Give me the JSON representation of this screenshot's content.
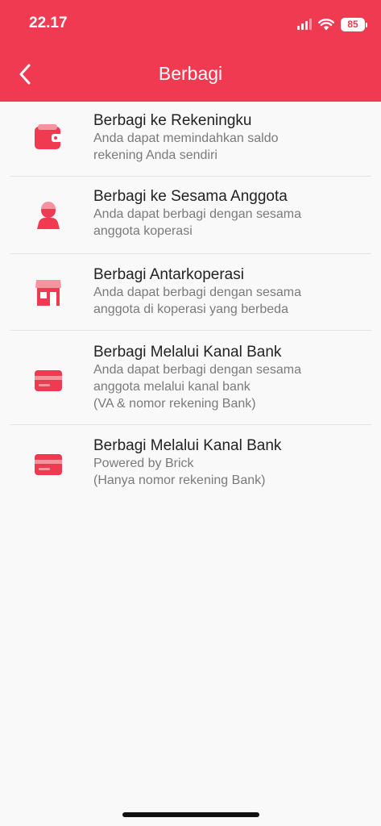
{
  "status_bar": {
    "time": "22.17",
    "battery": "85"
  },
  "nav": {
    "title": "Berbagi",
    "back_icon": "chevron-left-icon"
  },
  "colors": {
    "brand": "#f03a52",
    "background": "#f9f9f9",
    "divider": "#e4e4e4"
  },
  "menu": [
    {
      "title": "Berbagi ke Rekeningku",
      "desc": [
        "Anda dapat memindahkan saldo",
        "rekening Anda sendiri"
      ],
      "icon": "wallet-icon"
    },
    {
      "title": "Berbagi ke Sesama Anggota",
      "desc": [
        "Anda dapat berbagi dengan sesama",
        "anggota koperasi"
      ],
      "icon": "person-icon"
    },
    {
      "title": "Berbagi Antarkoperasi",
      "desc": [
        "Anda dapat berbagi dengan sesama",
        "anggota di koperasi yang berbeda"
      ],
      "icon": "store-icon"
    },
    {
      "title": "Berbagi Melalui Kanal Bank",
      "desc": [
        "Anda dapat berbagi dengan sesama",
        "anggota melalui kanal bank",
        "(VA & nomor rekening Bank)"
      ],
      "icon": "card-icon"
    },
    {
      "title": "Berbagi Melalui Kanal Bank",
      "desc": [
        "Powered by Brick",
        "(Hanya nomor rekening Bank)"
      ],
      "icon": "card-icon"
    }
  ]
}
